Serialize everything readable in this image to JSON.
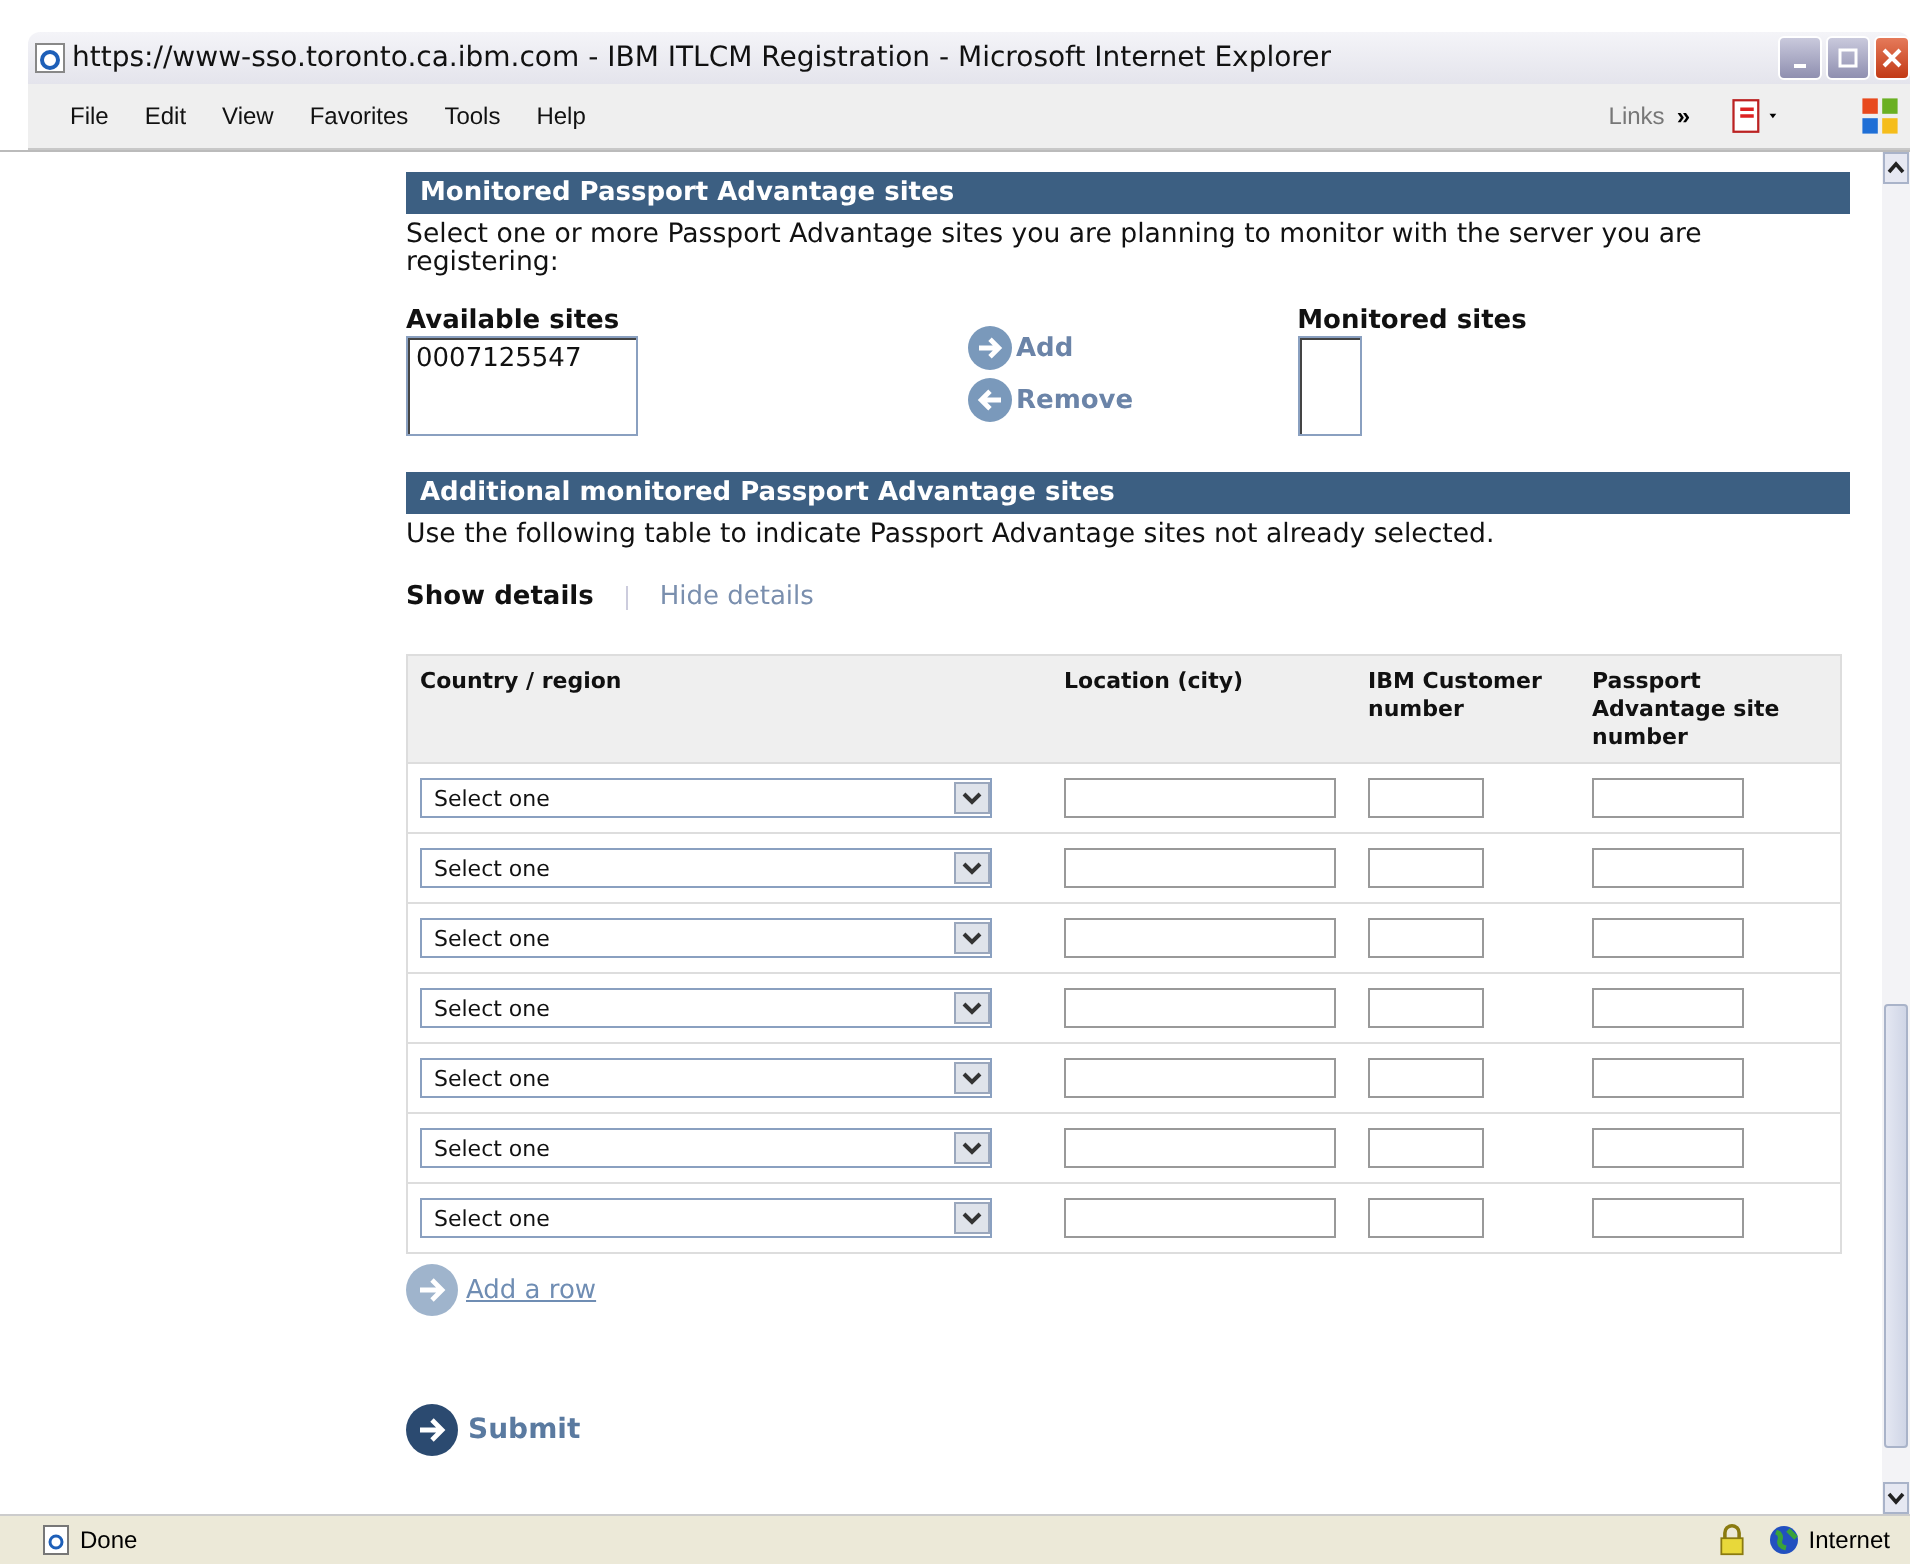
{
  "window": {
    "title": "https://www-sso.toronto.ca.ibm.com - IBM ITLCM Registration - Microsoft Internet Explorer"
  },
  "menu": [
    "File",
    "Edit",
    "View",
    "Favorites",
    "Tools",
    "Help"
  ],
  "links_label": "Links",
  "links_chevron": "»",
  "monitored": {
    "heading": "Monitored Passport Advantage sites",
    "intro": "Select one or more Passport Advantage sites you are planning to monitor with the server you are registering:",
    "available_label": "Available sites",
    "available": [
      "0007125547"
    ],
    "monitored_label": "Monitored sites",
    "add": "Add",
    "remove": "Remove"
  },
  "additional": {
    "heading": "Additional monitored Passport Advantage sites",
    "intro": "Use the following table to indicate Passport Advantage sites not already selected.",
    "details_toggle": [
      {
        "label": "Show details",
        "selected": true
      },
      {
        "label": "Hide details",
        "selected": false
      }
    ],
    "columns": [
      "Country / region",
      "Location (city)",
      "IBM Customer number",
      "Passport Advantage site number"
    ],
    "rows": [
      {
        "country": "Select one"
      },
      {
        "country": "Select one"
      },
      {
        "country": "Select one"
      },
      {
        "country": "Select one"
      },
      {
        "country": "Select one"
      },
      {
        "country": "Select one"
      },
      {
        "country": "Select one"
      }
    ],
    "add_row": "Add a row"
  },
  "submit": "Submit",
  "status_bar": {
    "status": "Done",
    "zone": "Internet"
  }
}
